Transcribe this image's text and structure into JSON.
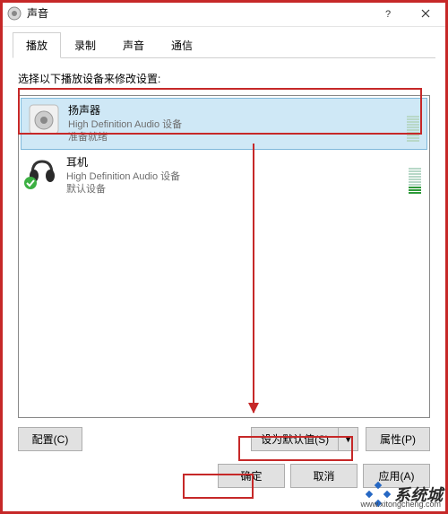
{
  "window": {
    "title": "声音"
  },
  "tabs": [
    {
      "label": "播放",
      "active": true
    },
    {
      "label": "录制",
      "active": false
    },
    {
      "label": "声音",
      "active": false
    },
    {
      "label": "通信",
      "active": false
    }
  ],
  "instruction": "选择以下播放设备来修改设置:",
  "devices": [
    {
      "name": "扬声器",
      "description": "High Definition Audio 设备",
      "status": "准备就绪",
      "icon": "speaker-icon",
      "selected": true,
      "default": false,
      "level_active": false
    },
    {
      "name": "耳机",
      "description": "High Definition Audio 设备",
      "status": "默认设备",
      "icon": "headphones-icon",
      "selected": false,
      "default": true,
      "level_active": true
    }
  ],
  "buttons": {
    "configure": "配置(C)",
    "set_default": "设为默认值(S)",
    "properties": "属性(P)",
    "ok": "确定",
    "cancel": "取消",
    "apply": "应用(A)"
  },
  "watermark": {
    "brand": "系统城",
    "url": "www.xitongcheng.com"
  },
  "highlight_color": "#c62828"
}
